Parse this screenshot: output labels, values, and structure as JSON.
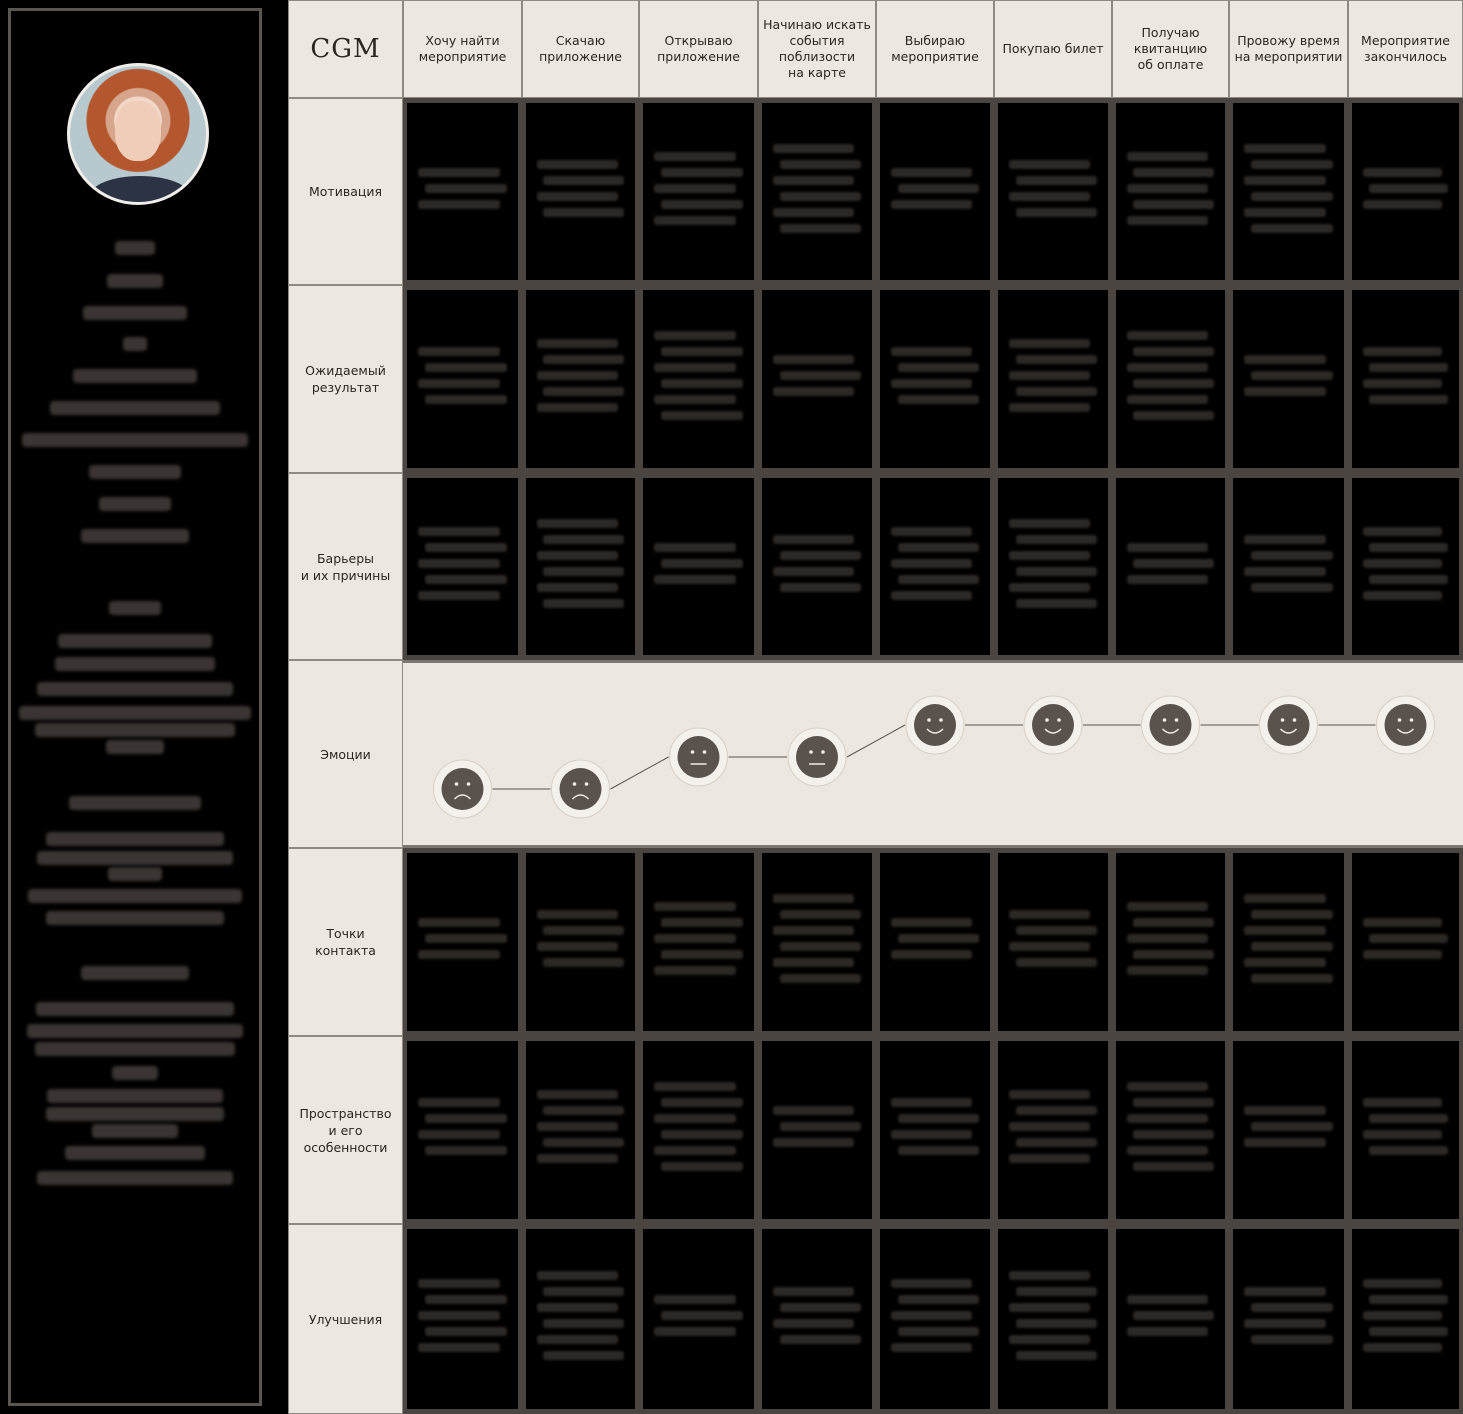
{
  "logo": "CGM",
  "stages": [
    "Хочу найти\nмероприятие",
    "Скачаю\nприложение",
    "Открываю\nприложение",
    "Начинаю искать\nсобытия\nпоблизости\nна карте",
    "Выбираю\nмероприятие",
    "Покупаю билет",
    "Получаю\nквитанцию\nоб оплате",
    "Провожу время\nна мероприятии",
    "Мероприятие\nзакончилось"
  ],
  "rows": [
    "Мотивация",
    "Ожидаемый\nрезультат",
    "Барьеры\nи их причины",
    "Эмоции",
    "Точки\nконтакта",
    "Пространство\nи его\nособенности",
    "Улучшения"
  ],
  "emotions": [
    "sad",
    "sad",
    "neutral",
    "neutral",
    "happy",
    "happy",
    "happy",
    "happy",
    "happy"
  ],
  "colors": {
    "header_bg": "#ece8e1",
    "face": "#5a524d",
    "face_ring": "#d6cec4",
    "cell_bg": "#000000"
  }
}
